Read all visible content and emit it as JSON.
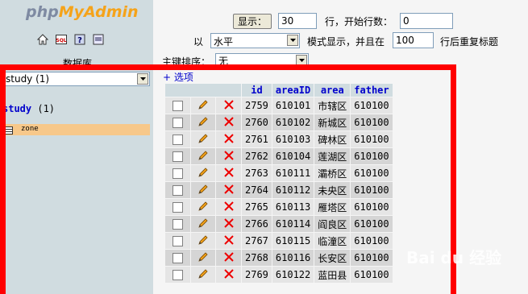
{
  "logo": {
    "part1": "php",
    "part2": "MyAdmin"
  },
  "nav": {
    "icons": [
      "home-icon",
      "sql-icon",
      "help-icon",
      "query-window-icon"
    ],
    "db_label": "数据库",
    "db_select": "study (1)",
    "db_title": "study",
    "db_count": "(1)",
    "tables": [
      "zone"
    ]
  },
  "controls": {
    "show_button": "显示：",
    "rows_value": "30",
    "start_row_label": "行，开始行数：",
    "start_row_value": "0",
    "mode_prefix": "以",
    "mode_value": "水平",
    "mode_suffix": "模式显示，并且在",
    "repeat_value": "100",
    "repeat_suffix": "行后重复标题",
    "sort_label": "主键排序：",
    "sort_value": "无",
    "options_link": "+ 选项"
  },
  "table": {
    "columns": [
      "id",
      "areaID",
      "area",
      "father"
    ],
    "rows": [
      [
        "2759",
        "610101",
        "市辖区",
        "610100"
      ],
      [
        "2760",
        "610102",
        "新城区",
        "610100"
      ],
      [
        "2761",
        "610103",
        "碑林区",
        "610100"
      ],
      [
        "2762",
        "610104",
        "莲湖区",
        "610100"
      ],
      [
        "2763",
        "610111",
        "灞桥区",
        "610100"
      ],
      [
        "2764",
        "610112",
        "未央区",
        "610100"
      ],
      [
        "2765",
        "610113",
        "雁塔区",
        "610100"
      ],
      [
        "2766",
        "610114",
        "阎良区",
        "610100"
      ],
      [
        "2767",
        "610115",
        "临潼区",
        "610100"
      ],
      [
        "2768",
        "610116",
        "长安区",
        "610100"
      ],
      [
        "2769",
        "610122",
        "蓝田县",
        "610100"
      ]
    ]
  },
  "watermark": "Bai du 经验",
  "colors": {
    "highlight": "#FF0000",
    "nav_bg": "#D0DCE0",
    "table_row_hover": "#F7C88A"
  }
}
